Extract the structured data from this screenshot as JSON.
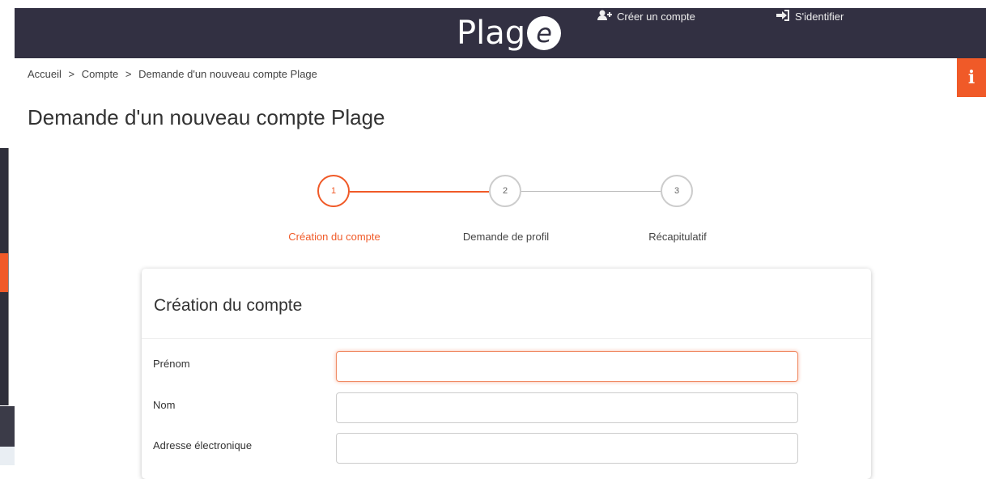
{
  "header": {
    "logo_text": "Plag",
    "logo_e": "e",
    "create_account": "Créer un compte",
    "login": "S'identifier"
  },
  "info_tab": {
    "glyph": "i"
  },
  "breadcrumb": {
    "items": [
      "Accueil",
      "Compte",
      "Demande d'un nouveau compte Plage"
    ],
    "separator": ">"
  },
  "page_title": "Demande d'un nouveau compte Plage",
  "stepper": {
    "steps": [
      {
        "number": "1",
        "label": "Création du compte",
        "active": true
      },
      {
        "number": "2",
        "label": "Demande de profil",
        "active": false
      },
      {
        "number": "3",
        "label": "Récapitulatif",
        "active": false
      }
    ]
  },
  "form": {
    "title": "Création du compte",
    "fields": [
      {
        "label": "Prénom",
        "value": ""
      },
      {
        "label": "Nom",
        "value": ""
      },
      {
        "label": "Adresse électronique",
        "value": ""
      }
    ]
  },
  "colors": {
    "accent": "#f05a28",
    "header_bg": "#323042"
  }
}
